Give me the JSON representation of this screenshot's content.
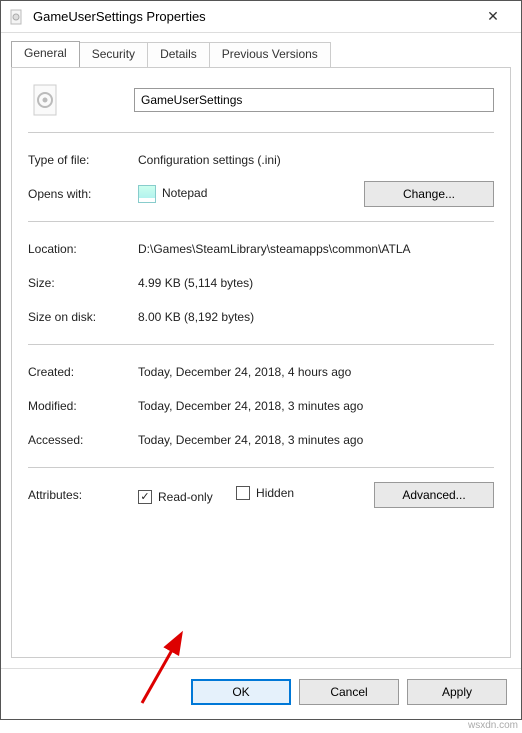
{
  "titlebar": {
    "title": "GameUserSettings Properties"
  },
  "tabs": {
    "general": "General",
    "security": "Security",
    "details": "Details",
    "previous": "Previous Versions"
  },
  "file": {
    "name": "GameUserSettings"
  },
  "fields": {
    "type_label": "Type of file:",
    "type_value": "Configuration settings (.ini)",
    "opens_label": "Opens with:",
    "opens_value": "Notepad",
    "change_btn": "Change...",
    "location_label": "Location:",
    "location_value": "D:\\Games\\SteamLibrary\\steamapps\\common\\ATLA",
    "size_label": "Size:",
    "size_value": "4.99 KB (5,114 bytes)",
    "sizeondisk_label": "Size on disk:",
    "sizeondisk_value": "8.00 KB (8,192 bytes)",
    "created_label": "Created:",
    "created_value": "Today, December 24, 2018, 4 hours ago",
    "modified_label": "Modified:",
    "modified_value": "Today, December 24, 2018, 3 minutes ago",
    "accessed_label": "Accessed:",
    "accessed_value": "Today, December 24, 2018, 3 minutes ago",
    "attributes_label": "Attributes:",
    "readonly_label": "Read-only",
    "hidden_label": "Hidden",
    "advanced_btn": "Advanced..."
  },
  "footer": {
    "ok": "OK",
    "cancel": "Cancel",
    "apply": "Apply"
  },
  "watermark": "wsxdn.com"
}
